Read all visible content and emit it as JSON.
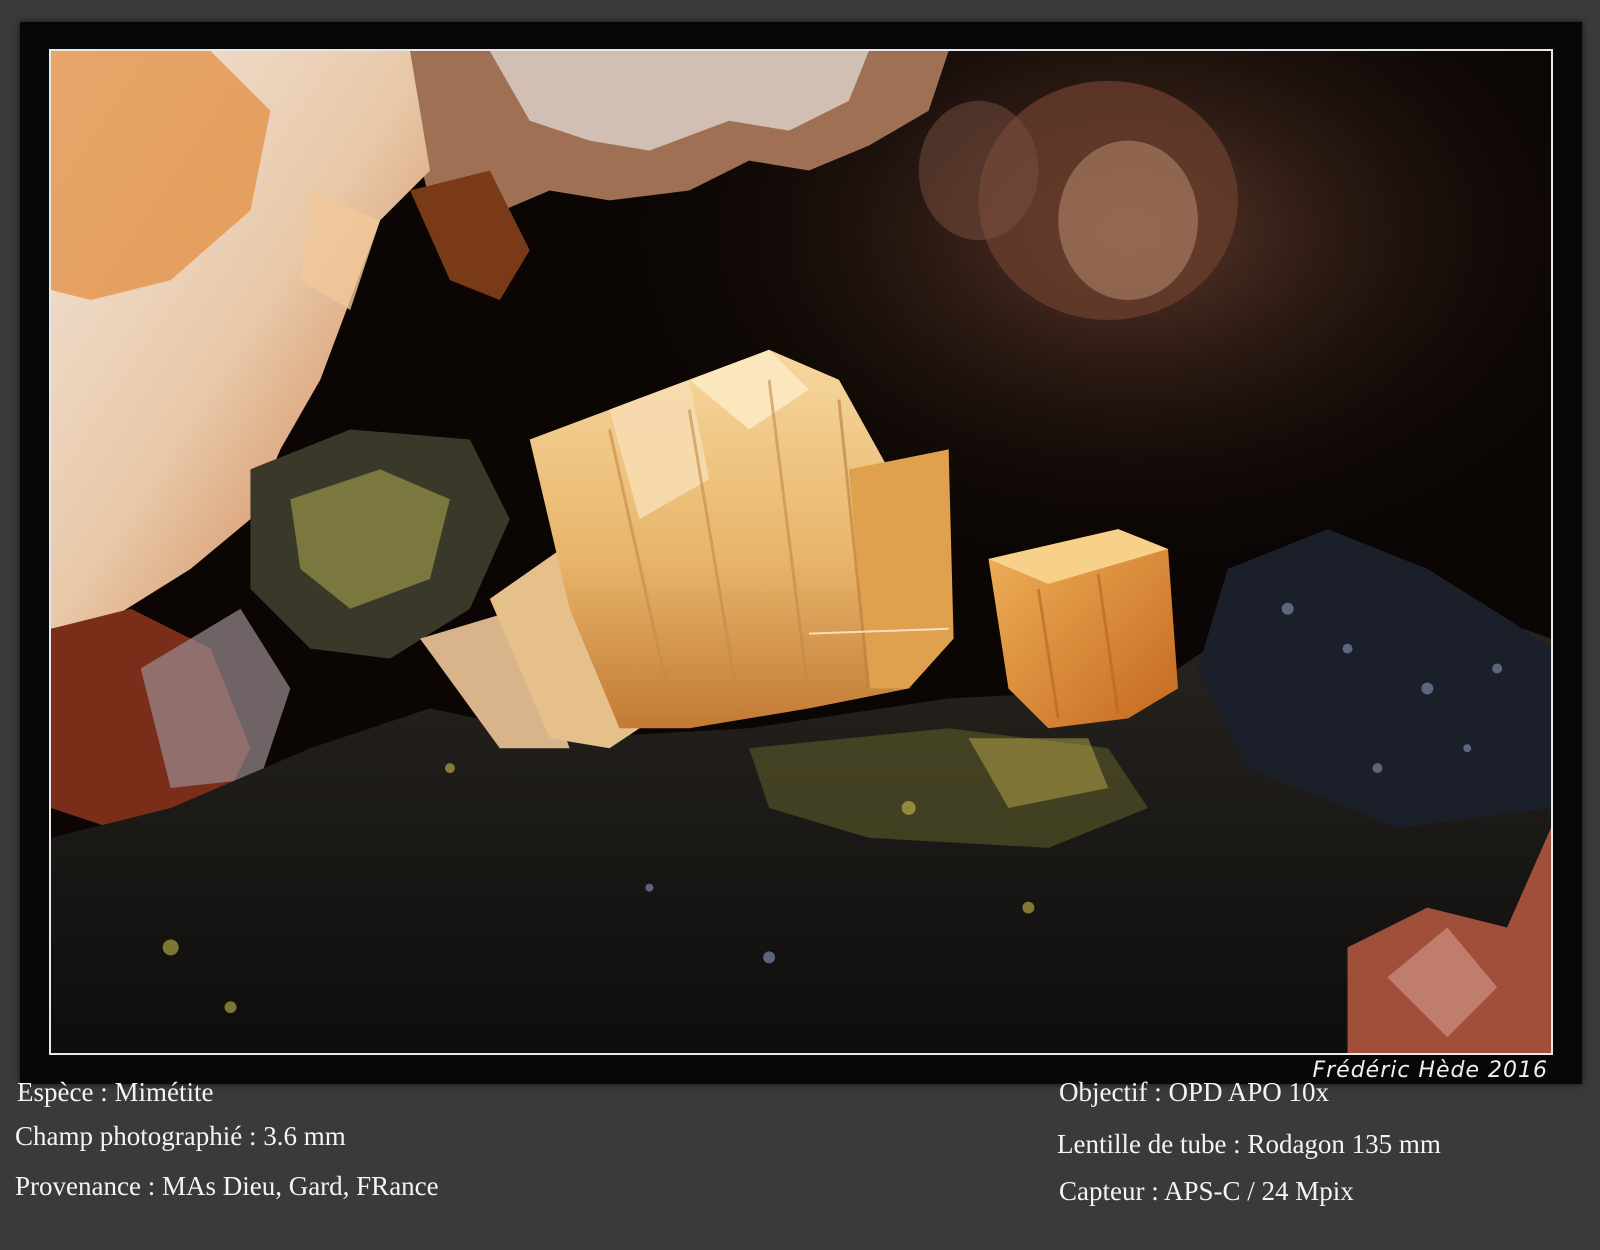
{
  "signature": "Frédéric Hède 2016",
  "captions": {
    "species": "Espèce : Mimétite",
    "field": "Champ photographié : 3.6 mm",
    "origin": "Provenance : MAs Dieu, Gard, FRance",
    "objective": "Objectif : OPD APO 10x",
    "tube_lens": "Lentille de tube : Rodagon 135 mm",
    "sensor": "Capteur : APS-C / 24 Mpix"
  },
  "colors": {
    "background": "#3a3a3a",
    "frame": "#070707",
    "border": "#e8e8e8",
    "crystal": "#e9a84a",
    "matrix": "#141414"
  }
}
